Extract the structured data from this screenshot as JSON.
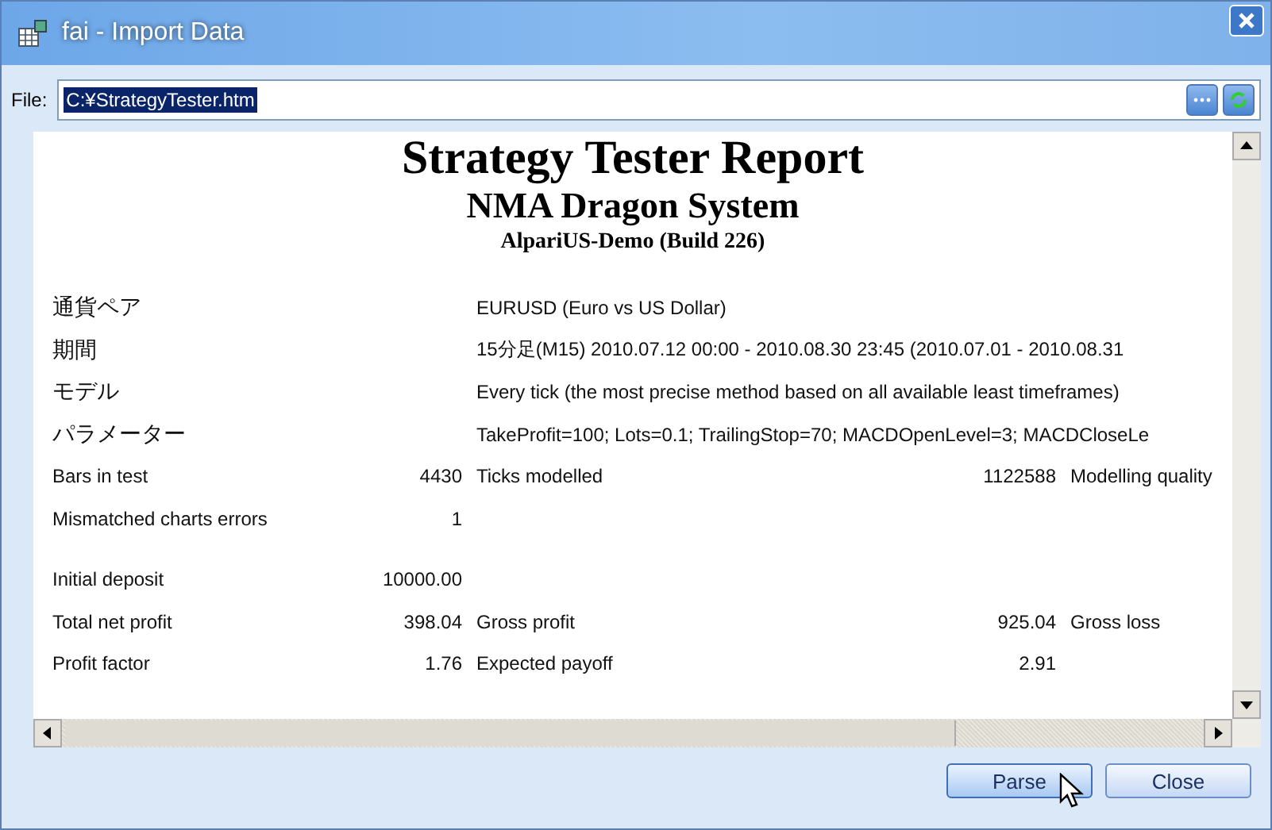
{
  "window": {
    "title": "fai - Import Data"
  },
  "file": {
    "label": "File:",
    "value": "C:¥StrategyTester.htm",
    "selected": true
  },
  "report": {
    "title": "Strategy Tester Report",
    "subtitle": "NMA Dragon System",
    "server": "AlpariUS-Demo (Build 226)",
    "rows": [
      {
        "kind": "info",
        "label": "通貨ペア",
        "value": "EURUSD (Euro vs US Dollar)"
      },
      {
        "kind": "info",
        "label": "期間",
        "value": "15分足(M15) 2010.07.12 00:00 - 2010.08.30 23:45 (2010.07.01 - 2010.08.31"
      },
      {
        "kind": "info",
        "label": "モデル",
        "value": "Every tick (the most precise method based on all available least timeframes)"
      },
      {
        "kind": "info",
        "label": "パラメーター",
        "value": "TakeProfit=100; Lots=0.1; TrailingStop=70; MACDOpenLevel=3; MACDCloseLe"
      },
      {
        "kind": "stat",
        "cells": [
          "Bars in test",
          "4430",
          "Ticks modelled",
          "1122588",
          "Modelling quality"
        ]
      },
      {
        "kind": "stat",
        "cells": [
          "Mismatched charts errors",
          "1"
        ]
      },
      {
        "kind": "gap"
      },
      {
        "kind": "stat",
        "cells": [
          "Initial deposit",
          "10000.00"
        ]
      },
      {
        "kind": "stat",
        "cells": [
          "Total net profit",
          "398.04",
          "Gross profit",
          "925.04",
          "Gross loss"
        ]
      },
      {
        "kind": "stat",
        "cells": [
          "Profit factor",
          "1.76",
          "Expected payoff",
          "2.91"
        ]
      }
    ]
  },
  "buttons": [
    {
      "label": "Parse",
      "hovered": true
    },
    {
      "label": "Close",
      "hovered": false
    }
  ]
}
